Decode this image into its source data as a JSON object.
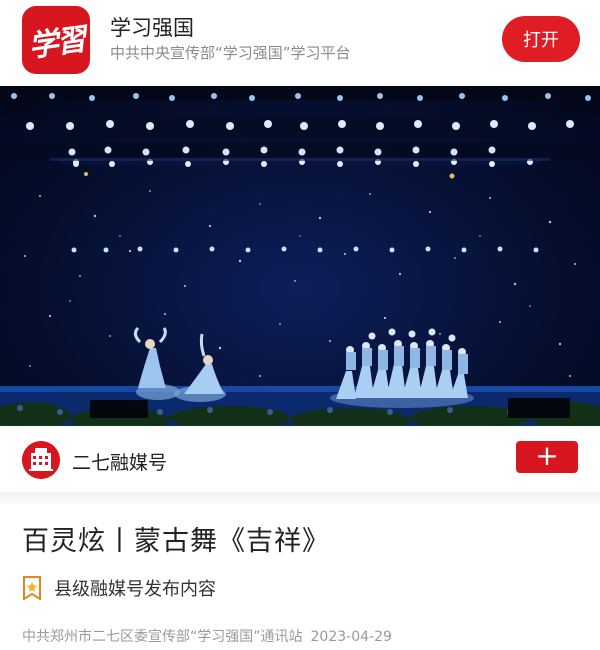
{
  "app_banner": {
    "logo_text": "学習",
    "app_name": "学习强国",
    "subtitle": "中共中央宣传部“学习强国”学习平台",
    "open_label": "打开"
  },
  "video": {
    "icon": "stage-performance-image"
  },
  "account": {
    "name": "二七融媒号",
    "follow_label": "+",
    "avatar_icon": "building-icon"
  },
  "article": {
    "title": "百灵炫丨蒙古舞《吉祥》",
    "tag_icon": "star-badge-icon",
    "tag_text": "县级融媒号发布内容",
    "source": "中共郑州市二七区委宣传部“学习强国”通讯站",
    "date": "2023-04-29"
  },
  "colors": {
    "brand_red": "#d7161f",
    "button_red": "#e01d24",
    "muted_text": "#9a9a9a"
  }
}
